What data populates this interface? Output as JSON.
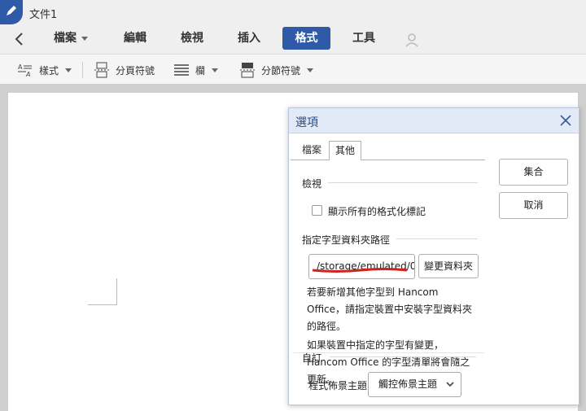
{
  "window": {
    "doc_title": "文件1"
  },
  "menu": {
    "items": [
      {
        "label": "檔案",
        "has_dropdown": true
      },
      {
        "label": "編輯"
      },
      {
        "label": "檢視"
      },
      {
        "label": "插入"
      },
      {
        "label": "格式",
        "active": true
      },
      {
        "label": "工具"
      }
    ],
    "accent_color": "#2f5aa8"
  },
  "toolbar": {
    "style_label": "樣式",
    "page_break_label": "分頁符號",
    "columns_label": "欄",
    "section_break_label": "分節符號"
  },
  "dialog": {
    "title": "選項",
    "tabs": {
      "file": "檔案",
      "other": "其他"
    },
    "view_section": "檢視",
    "show_marks_label": "顯示所有的格式化標記",
    "show_marks_checked": false,
    "font_path_section": "指定字型資料夾路徑",
    "font_path_value": "/storage/emulated/0",
    "change_folder_label": "變更資料夾",
    "note_line1": "若要新增其他字型到 Hancom Office，請指定裝置中安裝字型資料夾的路徑。",
    "note_line2": "如果裝置中指定的字型有變更，Hancom Office 的字型清單將會隨之更新。",
    "custom_section": "自訂",
    "theme_label": "程式佈景主題",
    "theme_value": "觸控佈景主題",
    "apply_label": "集合",
    "cancel_label": "取消"
  }
}
